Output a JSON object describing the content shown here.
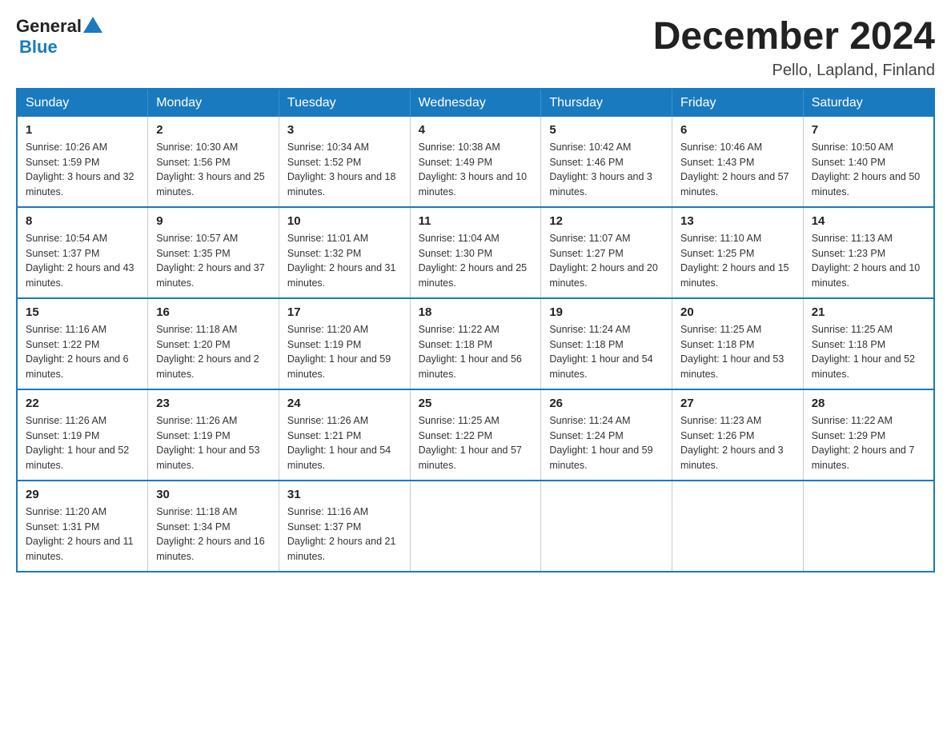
{
  "logo": {
    "general": "General",
    "blue": "Blue"
  },
  "title": "December 2024",
  "location": "Pello, Lapland, Finland",
  "weekdays": [
    "Sunday",
    "Monday",
    "Tuesday",
    "Wednesday",
    "Thursday",
    "Friday",
    "Saturday"
  ],
  "weeks": [
    [
      {
        "day": "1",
        "sunrise": "10:26 AM",
        "sunset": "1:59 PM",
        "daylight": "3 hours and 32 minutes."
      },
      {
        "day": "2",
        "sunrise": "10:30 AM",
        "sunset": "1:56 PM",
        "daylight": "3 hours and 25 minutes."
      },
      {
        "day": "3",
        "sunrise": "10:34 AM",
        "sunset": "1:52 PM",
        "daylight": "3 hours and 18 minutes."
      },
      {
        "day": "4",
        "sunrise": "10:38 AM",
        "sunset": "1:49 PM",
        "daylight": "3 hours and 10 minutes."
      },
      {
        "day": "5",
        "sunrise": "10:42 AM",
        "sunset": "1:46 PM",
        "daylight": "3 hours and 3 minutes."
      },
      {
        "day": "6",
        "sunrise": "10:46 AM",
        "sunset": "1:43 PM",
        "daylight": "2 hours and 57 minutes."
      },
      {
        "day": "7",
        "sunrise": "10:50 AM",
        "sunset": "1:40 PM",
        "daylight": "2 hours and 50 minutes."
      }
    ],
    [
      {
        "day": "8",
        "sunrise": "10:54 AM",
        "sunset": "1:37 PM",
        "daylight": "2 hours and 43 minutes."
      },
      {
        "day": "9",
        "sunrise": "10:57 AM",
        "sunset": "1:35 PM",
        "daylight": "2 hours and 37 minutes."
      },
      {
        "day": "10",
        "sunrise": "11:01 AM",
        "sunset": "1:32 PM",
        "daylight": "2 hours and 31 minutes."
      },
      {
        "day": "11",
        "sunrise": "11:04 AM",
        "sunset": "1:30 PM",
        "daylight": "2 hours and 25 minutes."
      },
      {
        "day": "12",
        "sunrise": "11:07 AM",
        "sunset": "1:27 PM",
        "daylight": "2 hours and 20 minutes."
      },
      {
        "day": "13",
        "sunrise": "11:10 AM",
        "sunset": "1:25 PM",
        "daylight": "2 hours and 15 minutes."
      },
      {
        "day": "14",
        "sunrise": "11:13 AM",
        "sunset": "1:23 PM",
        "daylight": "2 hours and 10 minutes."
      }
    ],
    [
      {
        "day": "15",
        "sunrise": "11:16 AM",
        "sunset": "1:22 PM",
        "daylight": "2 hours and 6 minutes."
      },
      {
        "day": "16",
        "sunrise": "11:18 AM",
        "sunset": "1:20 PM",
        "daylight": "2 hours and 2 minutes."
      },
      {
        "day": "17",
        "sunrise": "11:20 AM",
        "sunset": "1:19 PM",
        "daylight": "1 hour and 59 minutes."
      },
      {
        "day": "18",
        "sunrise": "11:22 AM",
        "sunset": "1:18 PM",
        "daylight": "1 hour and 56 minutes."
      },
      {
        "day": "19",
        "sunrise": "11:24 AM",
        "sunset": "1:18 PM",
        "daylight": "1 hour and 54 minutes."
      },
      {
        "day": "20",
        "sunrise": "11:25 AM",
        "sunset": "1:18 PM",
        "daylight": "1 hour and 53 minutes."
      },
      {
        "day": "21",
        "sunrise": "11:25 AM",
        "sunset": "1:18 PM",
        "daylight": "1 hour and 52 minutes."
      }
    ],
    [
      {
        "day": "22",
        "sunrise": "11:26 AM",
        "sunset": "1:19 PM",
        "daylight": "1 hour and 52 minutes."
      },
      {
        "day": "23",
        "sunrise": "11:26 AM",
        "sunset": "1:19 PM",
        "daylight": "1 hour and 53 minutes."
      },
      {
        "day": "24",
        "sunrise": "11:26 AM",
        "sunset": "1:21 PM",
        "daylight": "1 hour and 54 minutes."
      },
      {
        "day": "25",
        "sunrise": "11:25 AM",
        "sunset": "1:22 PM",
        "daylight": "1 hour and 57 minutes."
      },
      {
        "day": "26",
        "sunrise": "11:24 AM",
        "sunset": "1:24 PM",
        "daylight": "1 hour and 59 minutes."
      },
      {
        "day": "27",
        "sunrise": "11:23 AM",
        "sunset": "1:26 PM",
        "daylight": "2 hours and 3 minutes."
      },
      {
        "day": "28",
        "sunrise": "11:22 AM",
        "sunset": "1:29 PM",
        "daylight": "2 hours and 7 minutes."
      }
    ],
    [
      {
        "day": "29",
        "sunrise": "11:20 AM",
        "sunset": "1:31 PM",
        "daylight": "2 hours and 11 minutes."
      },
      {
        "day": "30",
        "sunrise": "11:18 AM",
        "sunset": "1:34 PM",
        "daylight": "2 hours and 16 minutes."
      },
      {
        "day": "31",
        "sunrise": "11:16 AM",
        "sunset": "1:37 PM",
        "daylight": "2 hours and 21 minutes."
      },
      null,
      null,
      null,
      null
    ]
  ]
}
